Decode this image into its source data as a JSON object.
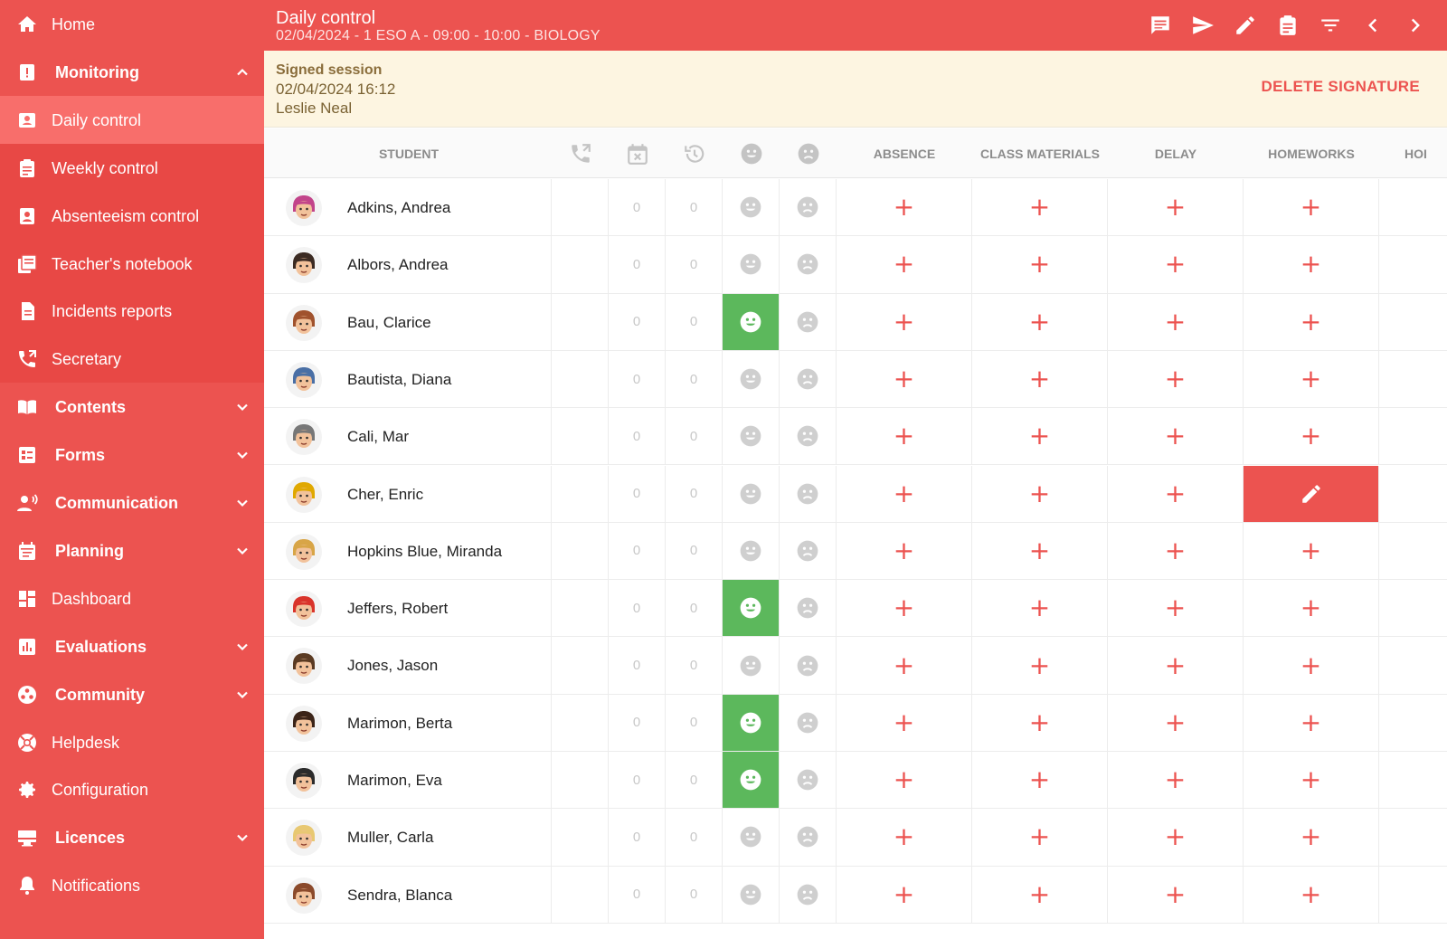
{
  "sidebar": {
    "items": [
      {
        "label": "Home",
        "icon": "home-icon",
        "kind": "item"
      },
      {
        "label": "Monitoring",
        "icon": "alert-icon",
        "kind": "group-open"
      },
      {
        "label": "Daily control",
        "icon": "contact-icon",
        "kind": "sub-active"
      },
      {
        "label": "Weekly control",
        "icon": "clipboard-icon",
        "kind": "sub"
      },
      {
        "label": "Absenteeism control",
        "icon": "badge-icon",
        "kind": "sub"
      },
      {
        "label": "Teacher's notebook",
        "icon": "notebook-icon",
        "kind": "sub"
      },
      {
        "label": "Incidents reports",
        "icon": "document-icon",
        "kind": "sub"
      },
      {
        "label": "Secretary",
        "icon": "phone-icon",
        "kind": "sub"
      },
      {
        "label": "Contents",
        "icon": "book-icon",
        "kind": "group"
      },
      {
        "label": "Forms",
        "icon": "form-icon",
        "kind": "group"
      },
      {
        "label": "Communication",
        "icon": "speaker-icon",
        "kind": "group"
      },
      {
        "label": "Planning",
        "icon": "calendar-icon",
        "kind": "group"
      },
      {
        "label": "Dashboard",
        "icon": "dashboard-icon",
        "kind": "item"
      },
      {
        "label": "Evaluations",
        "icon": "chart-icon",
        "kind": "group"
      },
      {
        "label": "Community",
        "icon": "community-icon",
        "kind": "group"
      },
      {
        "label": "Helpdesk",
        "icon": "lifebuoy-icon",
        "kind": "item"
      },
      {
        "label": "Configuration",
        "icon": "gear-icon",
        "kind": "item"
      },
      {
        "label": "Licences",
        "icon": "licence-icon",
        "kind": "group"
      },
      {
        "label": "Notifications",
        "icon": "bell-icon",
        "kind": "item"
      }
    ]
  },
  "header": {
    "title": "Daily control",
    "subtitle": "02/04/2024 - 1 ESO A - 09:00 - 10:00 - BIOLOGY",
    "icons": [
      "message-icon",
      "send-icon",
      "pencil-icon",
      "clipboard-icon",
      "filter-icon",
      "chevron-left-icon",
      "chevron-right-icon"
    ]
  },
  "banner": {
    "title": "Signed session",
    "datetime": "02/04/2024 16:12",
    "signer": "Leslie Neal",
    "action": "DELETE SIGNATURE"
  },
  "table": {
    "columns": {
      "student": "STUDENT",
      "absence": "ABSENCE",
      "class_materials": "CLASS MATERIALS",
      "delay": "DELAY",
      "homeworks": "HOMEWORKS",
      "more": "HOI"
    },
    "icon_columns": [
      "phone-icon",
      "calendar-x-icon",
      "history-icon",
      "happy-face-icon",
      "sad-face-icon"
    ],
    "rows": [
      {
        "name": "Adkins, Andrea",
        "c1": "0",
        "c2": "0",
        "happy": false,
        "hw_edit": false,
        "avatar": "#c2448a"
      },
      {
        "name": "Albors, Andrea",
        "c1": "0",
        "c2": "0",
        "happy": false,
        "hw_edit": false,
        "avatar": "#3b2a22"
      },
      {
        "name": "Bau, Clarice",
        "c1": "0",
        "c2": "0",
        "happy": true,
        "hw_edit": false,
        "avatar": "#a0522d"
      },
      {
        "name": "Bautista, Diana",
        "c1": "0",
        "c2": "0",
        "happy": false,
        "hw_edit": false,
        "avatar": "#4a6fa5"
      },
      {
        "name": "Cali, Mar",
        "c1": "0",
        "c2": "0",
        "happy": false,
        "hw_edit": false,
        "avatar": "#777777"
      },
      {
        "name": "Cher, Enric",
        "c1": "0",
        "c2": "0",
        "happy": false,
        "hw_edit": true,
        "avatar": "#e0a800"
      },
      {
        "name": "Hopkins Blue, Miranda",
        "c1": "0",
        "c2": "0",
        "happy": false,
        "hw_edit": false,
        "avatar": "#d8a547"
      },
      {
        "name": "Jeffers, Robert",
        "c1": "0",
        "c2": "0",
        "happy": true,
        "hw_edit": false,
        "avatar": "#d9342b"
      },
      {
        "name": "Jones, Jason",
        "c1": "0",
        "c2": "0",
        "happy": false,
        "hw_edit": false,
        "avatar": "#5a3a22"
      },
      {
        "name": "Marimon, Berta",
        "c1": "0",
        "c2": "0",
        "happy": true,
        "hw_edit": false,
        "avatar": "#3b2418"
      },
      {
        "name": "Marimon, Eva",
        "c1": "0",
        "c2": "0",
        "happy": true,
        "hw_edit": false,
        "avatar": "#2b2b2b"
      },
      {
        "name": "Muller, Carla",
        "c1": "0",
        "c2": "0",
        "happy": false,
        "hw_edit": false,
        "avatar": "#e8c872"
      },
      {
        "name": "Sendra, Blanca",
        "c1": "0",
        "c2": "0",
        "happy": false,
        "hw_edit": false,
        "avatar": "#8b4a2b"
      }
    ],
    "plus_symbol": "+"
  },
  "colors": {
    "accent": "#ec5350",
    "active_item": "#f86e6b",
    "banner_bg": "#fdf5e1",
    "happy_green": "#5cb85c"
  }
}
